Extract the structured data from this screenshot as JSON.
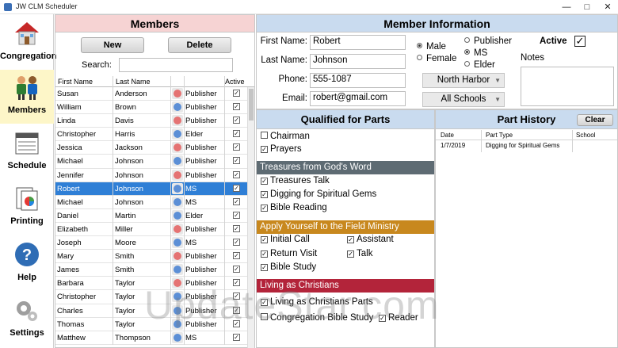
{
  "window": {
    "title": "JW CLM Scheduler"
  },
  "nav": {
    "items": [
      {
        "label": "Congregation",
        "icon": "house-icon"
      },
      {
        "label": "Members",
        "icon": "members-icon"
      },
      {
        "label": "Schedule",
        "icon": "schedule-icon"
      },
      {
        "label": "Printing",
        "icon": "printing-icon"
      },
      {
        "label": "Help",
        "icon": "help-icon"
      },
      {
        "label": "Settings",
        "icon": "settings-icon"
      }
    ]
  },
  "members": {
    "title": "Members",
    "new_label": "New",
    "delete_label": "Delete",
    "search_label": "Search:",
    "search_value": "",
    "columns": {
      "first": "First Name",
      "last": "Last Name",
      "active": "Active"
    },
    "rows": [
      {
        "first": "Susan",
        "last": "Anderson",
        "status": "Publisher",
        "gender": "f"
      },
      {
        "first": "William",
        "last": "Brown",
        "status": "Publisher",
        "gender": "m"
      },
      {
        "first": "Linda",
        "last": "Davis",
        "status": "Publisher",
        "gender": "f"
      },
      {
        "first": "Christopher",
        "last": "Harris",
        "status": "Elder",
        "gender": "m"
      },
      {
        "first": "Jessica",
        "last": "Jackson",
        "status": "Publisher",
        "gender": "f"
      },
      {
        "first": "Michael",
        "last": "Johnson",
        "status": "Publisher",
        "gender": "m"
      },
      {
        "first": "Jennifer",
        "last": "Johnson",
        "status": "Publisher",
        "gender": "f"
      },
      {
        "first": "Robert",
        "last": "Johnson",
        "status": "MS",
        "gender": "m"
      },
      {
        "first": "Michael",
        "last": "Johnson",
        "status": "MS",
        "gender": "m"
      },
      {
        "first": "Daniel",
        "last": "Martin",
        "status": "Elder",
        "gender": "m"
      },
      {
        "first": "Elizabeth",
        "last": "Miller",
        "status": "Publisher",
        "gender": "f"
      },
      {
        "first": "Joseph",
        "last": "Moore",
        "status": "MS",
        "gender": "m"
      },
      {
        "first": "Mary",
        "last": "Smith",
        "status": "Publisher",
        "gender": "f"
      },
      {
        "first": "James",
        "last": "Smith",
        "status": "Publisher",
        "gender": "m"
      },
      {
        "first": "Barbara",
        "last": "Taylor",
        "status": "Publisher",
        "gender": "f"
      },
      {
        "first": "Christopher",
        "last": "Taylor",
        "status": "Publisher",
        "gender": "m"
      },
      {
        "first": "Charles",
        "last": "Taylor",
        "status": "Publisher",
        "gender": "m"
      },
      {
        "first": "Thomas",
        "last": "Taylor",
        "status": "Publisher",
        "gender": "m"
      },
      {
        "first": "Matthew",
        "last": "Thompson",
        "status": "MS",
        "gender": "m"
      }
    ],
    "selected_index": 7,
    "check_glyph": "✓"
  },
  "info": {
    "title": "Member Information",
    "first_label": "First Name:",
    "first_value": "Robert",
    "last_label": "Last Name:",
    "last_value": "Johnson",
    "phone_label": "Phone:",
    "phone_value": "555-1087",
    "email_label": "Email:",
    "email_value": "robert@gmail.com",
    "male_label": "Male",
    "female_label": "Female",
    "publisher_label": "Publisher",
    "ms_label": "MS",
    "elder_label": "Elder",
    "active_label": "Active",
    "notes_label": "Notes",
    "group_value": "North Harbor",
    "school_value": "All Schools"
  },
  "qualified": {
    "title": "Qualified for Parts",
    "chairman": "Chairman",
    "prayers": "Prayers",
    "treasures_band": "Treasures from God's Word",
    "treasures_talk": "Treasures Talk",
    "digging": "Digging for Spiritual Gems",
    "bible_reading": "Bible Reading",
    "apply_band": "Apply Yourself to the Field Ministry",
    "initial_call": "Initial Call",
    "assistant": "Assistant",
    "return_visit": "Return Visit",
    "talk": "Talk",
    "bible_study": "Bible Study",
    "living_band": "Living as Christians",
    "living_parts": "Living as Christians Parts",
    "cbs": "Congregation Bible Study",
    "reader": "Reader",
    "colors": {
      "treasures": "#5e6b73",
      "apply": "#c8881e",
      "living": "#b3243a"
    }
  },
  "history": {
    "title": "Part History",
    "clear_label": "Clear",
    "columns": {
      "date": "Date",
      "part_type": "Part Type",
      "school": "School"
    },
    "rows": [
      {
        "date": "1/7/2019",
        "part_type": "Digging for Spiritual Gems",
        "school": ""
      }
    ]
  },
  "watermark": "UpdateStar.com"
}
